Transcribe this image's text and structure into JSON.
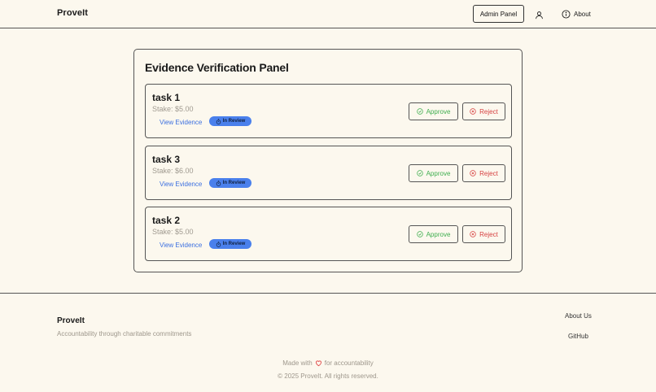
{
  "header": {
    "brand": "ProveIt",
    "admin_panel_label": "Admin Panel",
    "user_icon": "user-icon",
    "about_label": "About",
    "about_icon": "info-icon"
  },
  "panel": {
    "title": "Evidence Verification Panel",
    "tasks": [
      {
        "name": "task 1",
        "stake": "Stake: $5.00",
        "view_evidence": "View Evidence",
        "status": "In Review",
        "approve": "Approve",
        "reject": "Reject"
      },
      {
        "name": "task 3",
        "stake": "Stake: $6.00",
        "view_evidence": "View Evidence",
        "status": "In Review",
        "approve": "Approve",
        "reject": "Reject"
      },
      {
        "name": "task 2",
        "stake": "Stake: $5.00",
        "view_evidence": "View Evidence",
        "status": "In Review",
        "approve": "Approve",
        "reject": "Reject"
      }
    ]
  },
  "footer": {
    "brand": "ProveIt",
    "tagline": "Accountability through charitable commitments",
    "links": {
      "about": "About Us",
      "github": "GitHub"
    },
    "made_with_prefix": "Made with",
    "made_with_suffix": "for accountability",
    "copyright": "© 2025 ProveIt. All rights reserved."
  },
  "colors": {
    "background": "#fcf8ee",
    "approve": "#3fae4f",
    "reject": "#d64040",
    "link": "#3b6fe0",
    "badge": "#4a80ec",
    "heart": "#e04848"
  }
}
